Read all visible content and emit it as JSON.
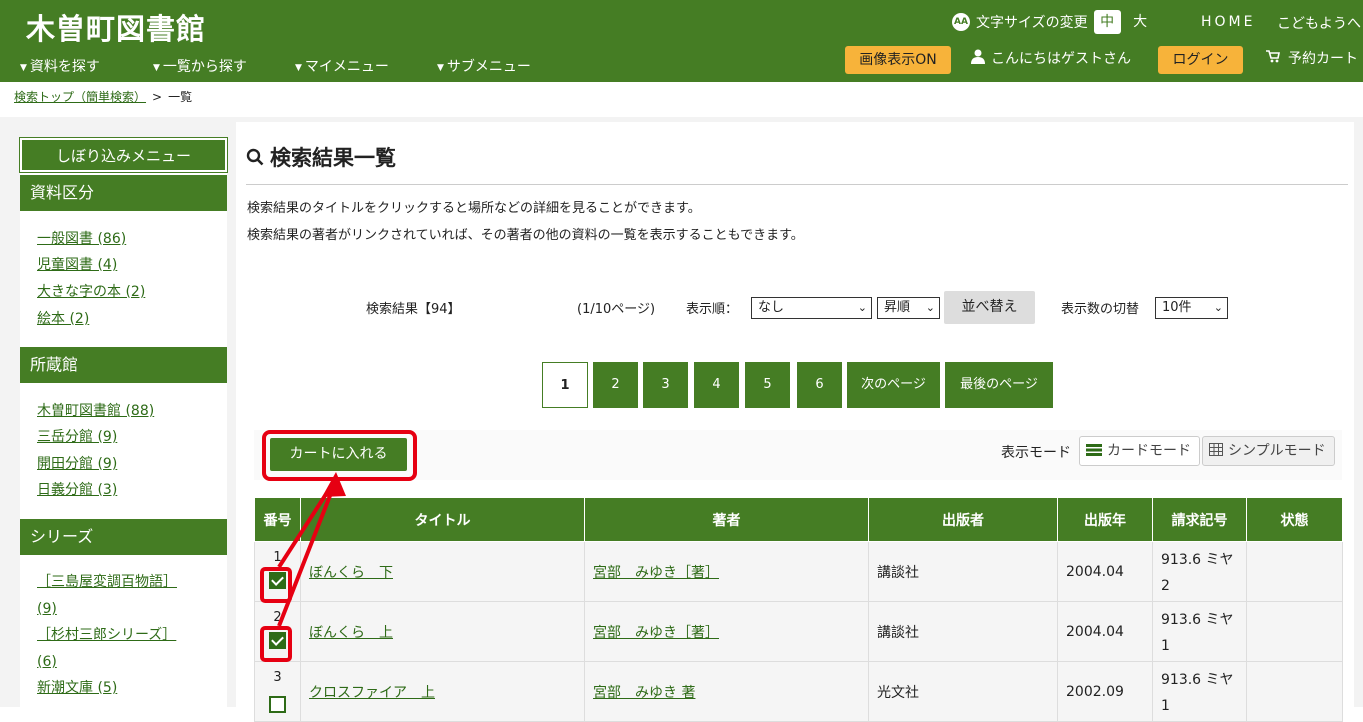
{
  "header": {
    "site_title": "木曽町図書館",
    "nav": [
      "資料を探す",
      "一覧から探す",
      "マイメニュー",
      "サブメニュー"
    ],
    "font_size_label": "文字サイズの変更",
    "font_size_options": [
      "中",
      "大"
    ],
    "home": "HOME",
    "kids": "こどもようへ",
    "image_toggle": "画像表示ON",
    "greeting": "こんにちはゲストさん",
    "login": "ログイン",
    "cart": "予約カート"
  },
  "breadcrumb": {
    "link": "検索トップ（簡単検索）",
    "sep": ">",
    "current": "一覧"
  },
  "sidebar": {
    "title": "しぼり込みメニュー",
    "sections": [
      {
        "heading": "資料区分",
        "items": [
          "一般図書 (86)",
          "児童図書 (4)",
          "大きな字の本 (2)",
          "絵本 (2)"
        ]
      },
      {
        "heading": "所蔵館",
        "items": [
          "木曽町図書館 (88)",
          "三岳分館 (9)",
          "開田分館 (9)",
          "日義分館 (3)"
        ]
      },
      {
        "heading": "シリーズ",
        "items": [
          "［三島屋変調百物語］",
          "(9)",
          "［杉村三郎シリーズ］",
          "(6)",
          "新潮文庫 (5)"
        ]
      }
    ]
  },
  "main": {
    "title": "検索結果一覧",
    "desc1": "検索結果のタイトルをクリックすると場所などの詳細を見ることができます。",
    "desc2": "検索結果の著者がリンクされていれば、その著者の他の資料の一覧を表示することもできます。",
    "result_count": "検索結果【94】",
    "page_info": "(1/10ページ)",
    "sort_label": "表示順：",
    "sort_value": "なし",
    "order_value": "昇順",
    "sort_button": "並べ替え",
    "per_page_label": "表示数の切替",
    "per_page_value": "10件",
    "pagination": [
      "1",
      "2",
      "3",
      "4",
      "5",
      "6",
      "次のページ",
      "最後のページ"
    ],
    "add_to_cart": "カートに入れる",
    "mode_label": "表示モード",
    "card_mode": "カードモード",
    "simple_mode": "シンプルモード"
  },
  "table": {
    "headers": [
      "番号",
      "タイトル",
      "著者",
      "出版者",
      "出版年",
      "請求記号",
      "状態"
    ],
    "rows": [
      {
        "num": "1",
        "title": "ぼんくら　下",
        "author": "宮部　みゆき［著］",
        "publisher": "講談社",
        "year": "2004.04",
        "call": "913.6 ミヤ 2",
        "status": "",
        "checked": true
      },
      {
        "num": "2",
        "title": "ぼんくら　上",
        "author": "宮部　みゆき［著］",
        "publisher": "講談社",
        "year": "2004.04",
        "call": "913.6 ミヤ 1",
        "status": "",
        "checked": true
      },
      {
        "num": "3",
        "title": "クロスファイア　上",
        "author": "宮部　みゆき 著",
        "publisher": "光文社",
        "year": "2002.09",
        "call": "913.6 ミヤ 1",
        "status": "",
        "checked": false
      }
    ]
  },
  "colors": {
    "primary": "#457d24",
    "accent": "#f7b33a",
    "highlight": "#e60012"
  }
}
